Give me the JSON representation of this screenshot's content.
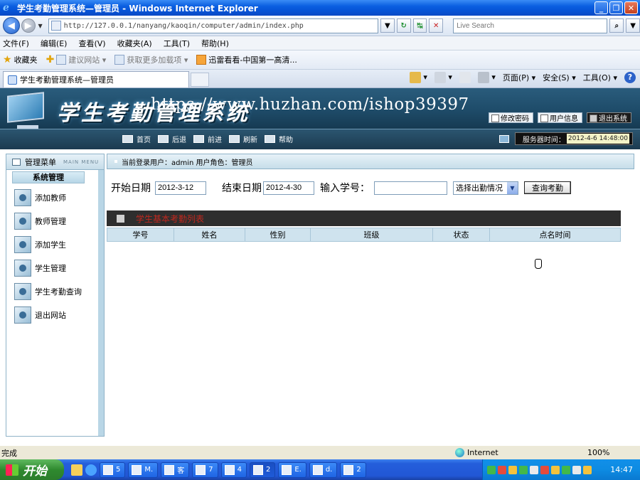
{
  "window": {
    "title": "学生考勤管理系统—管理员 - Windows Internet Explorer",
    "min": "_",
    "restore": "❐",
    "close": "✕"
  },
  "addressbar": {
    "url": "http://127.0.0.1/nanyang/kaoqin/computer/admin/index.php",
    "search_placeholder": "Live Search",
    "back": "◀",
    "forward": "▶",
    "dropdown": "▼",
    "refresh": "↻",
    "go": "↹",
    "stop": "✕",
    "search_go": "⌕"
  },
  "menubar": [
    "文件(F)",
    "编辑(E)",
    "查看(V)",
    "收藏夹(A)",
    "工具(T)",
    "帮助(H)"
  ],
  "favorites": {
    "label": "收藏夹",
    "items": [
      "建议网站 ▾",
      "获取更多加载项 ▾",
      "迅雷看看-中国第一高清..."
    ]
  },
  "tab": {
    "label": "学生考勤管理系统—管理员"
  },
  "commandbar": {
    "page": "页面(P) ▾",
    "safety": "安全(S) ▾",
    "tools": "工具(O) ▾",
    "help": "?",
    "home_caret": "▾",
    "feeds_caret": "▾",
    "print_caret": "▾"
  },
  "header": {
    "system_title": "学生考勤管理系统",
    "watermark": "https://www.huzhan.com/ishop39397",
    "buttons": [
      "修改密码",
      "用户信息",
      "退出系统"
    ]
  },
  "nav": {
    "links": [
      "首页",
      "后退",
      "前进",
      "刷新",
      "帮助"
    ],
    "server_label": "服务器时间：",
    "server_time": "2012-4-6 14:48:00"
  },
  "sidebar": {
    "title": "管理菜单",
    "title_en": "MAIN MENU",
    "section": "系统管理",
    "items": [
      "添加教师",
      "教师管理",
      "添加学生",
      "学生管理",
      "学生考勤查询",
      "退出网站"
    ]
  },
  "main": {
    "current_user": "当前登录用户：admin  用户角色：管理员",
    "filters": {
      "start_label": "开始日期",
      "start_value": "2012-3-12",
      "end_label": "结束日期",
      "end_value": "2012-4-30",
      "sid_label": "输入学号：",
      "sid_value": "",
      "status_select": "选择出勤情况",
      "query_button": "查询考勤"
    },
    "result_title": "学生基本考勤列表",
    "columns": [
      "学号",
      "姓名",
      "性别",
      "班级",
      "状态",
      "点名时间"
    ]
  },
  "statusbar": {
    "text": "完成",
    "zone": "Internet",
    "zoom": "100%"
  },
  "taskbar": {
    "start": "开始",
    "buttons": [
      "5",
      "M.",
      "客",
      "7",
      "4",
      "2",
      "E.",
      "d.",
      "2"
    ],
    "clock": "14:47"
  }
}
